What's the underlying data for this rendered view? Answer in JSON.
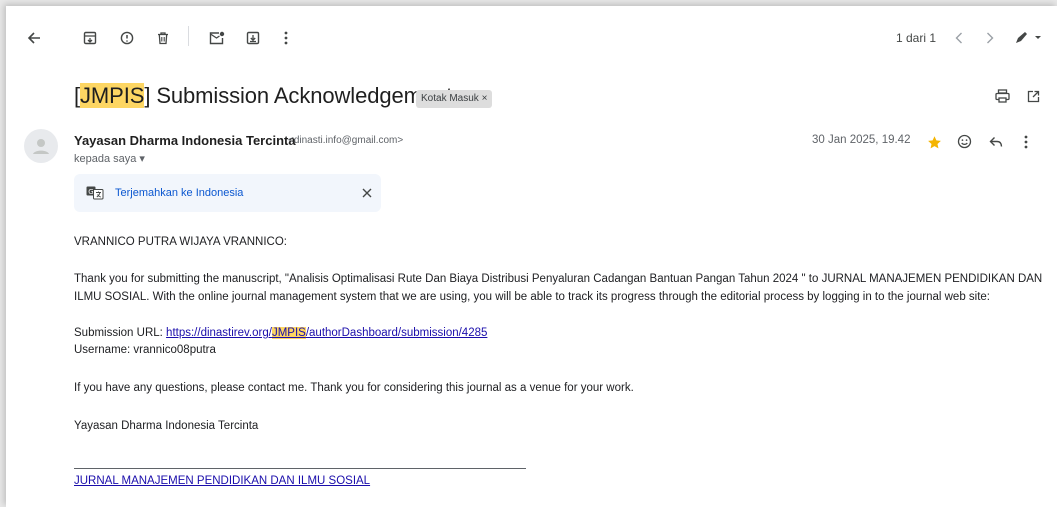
{
  "toolbar": {
    "pager_text": "1 dari 1"
  },
  "subject": {
    "prefix": "[",
    "highlight": "JMPIS",
    "rest": "] Submission Acknowledgement",
    "label": "Kotak Masuk ×"
  },
  "sender": {
    "name": "Yayasan Dharma Indonesia Tercinta",
    "email": "<dinasti.info@gmail.com>",
    "to": "kepada saya ▾",
    "date": "30 Jan 2025, 19.42"
  },
  "translate": {
    "label": "Terjemahkan ke Indonesia"
  },
  "body": {
    "greeting": "VRANNICO PUTRA WIJAYA VRANNICO:",
    "paragraph1": "Thank you for submitting the manuscript, \"Analisis Optimalisasi Rute Dan Biaya Distribusi Penyaluran Cadangan Bantuan Pangan Tahun 2024 \" to JURNAL MANAJEMEN PENDIDIKAN DAN ILMU SOSIAL. With the online journal management system that we are using, you will be able to track its progress through the editorial process by logging in to the journal web site:",
    "url_label": "Submission URL: ",
    "url_prefix": "https://dinastirev.org/",
    "url_highlight": "JMPIS",
    "url_suffix": "/authorDashboard/submission/4285",
    "username": "Username: vrannico08putra",
    "questions": "If you have any questions, please contact me. Thank you for considering this journal as a venue for your work.",
    "signoff": "Yayasan Dharma Indonesia Tercinta",
    "journal_link": "JURNAL MANAJEMEN PENDIDIKAN DAN ILMU SOSIAL"
  },
  "colors": {
    "highlight": "#fdd663",
    "star": "#f4b400",
    "link": "#1a0dab",
    "translate_link": "#0b57d0"
  }
}
